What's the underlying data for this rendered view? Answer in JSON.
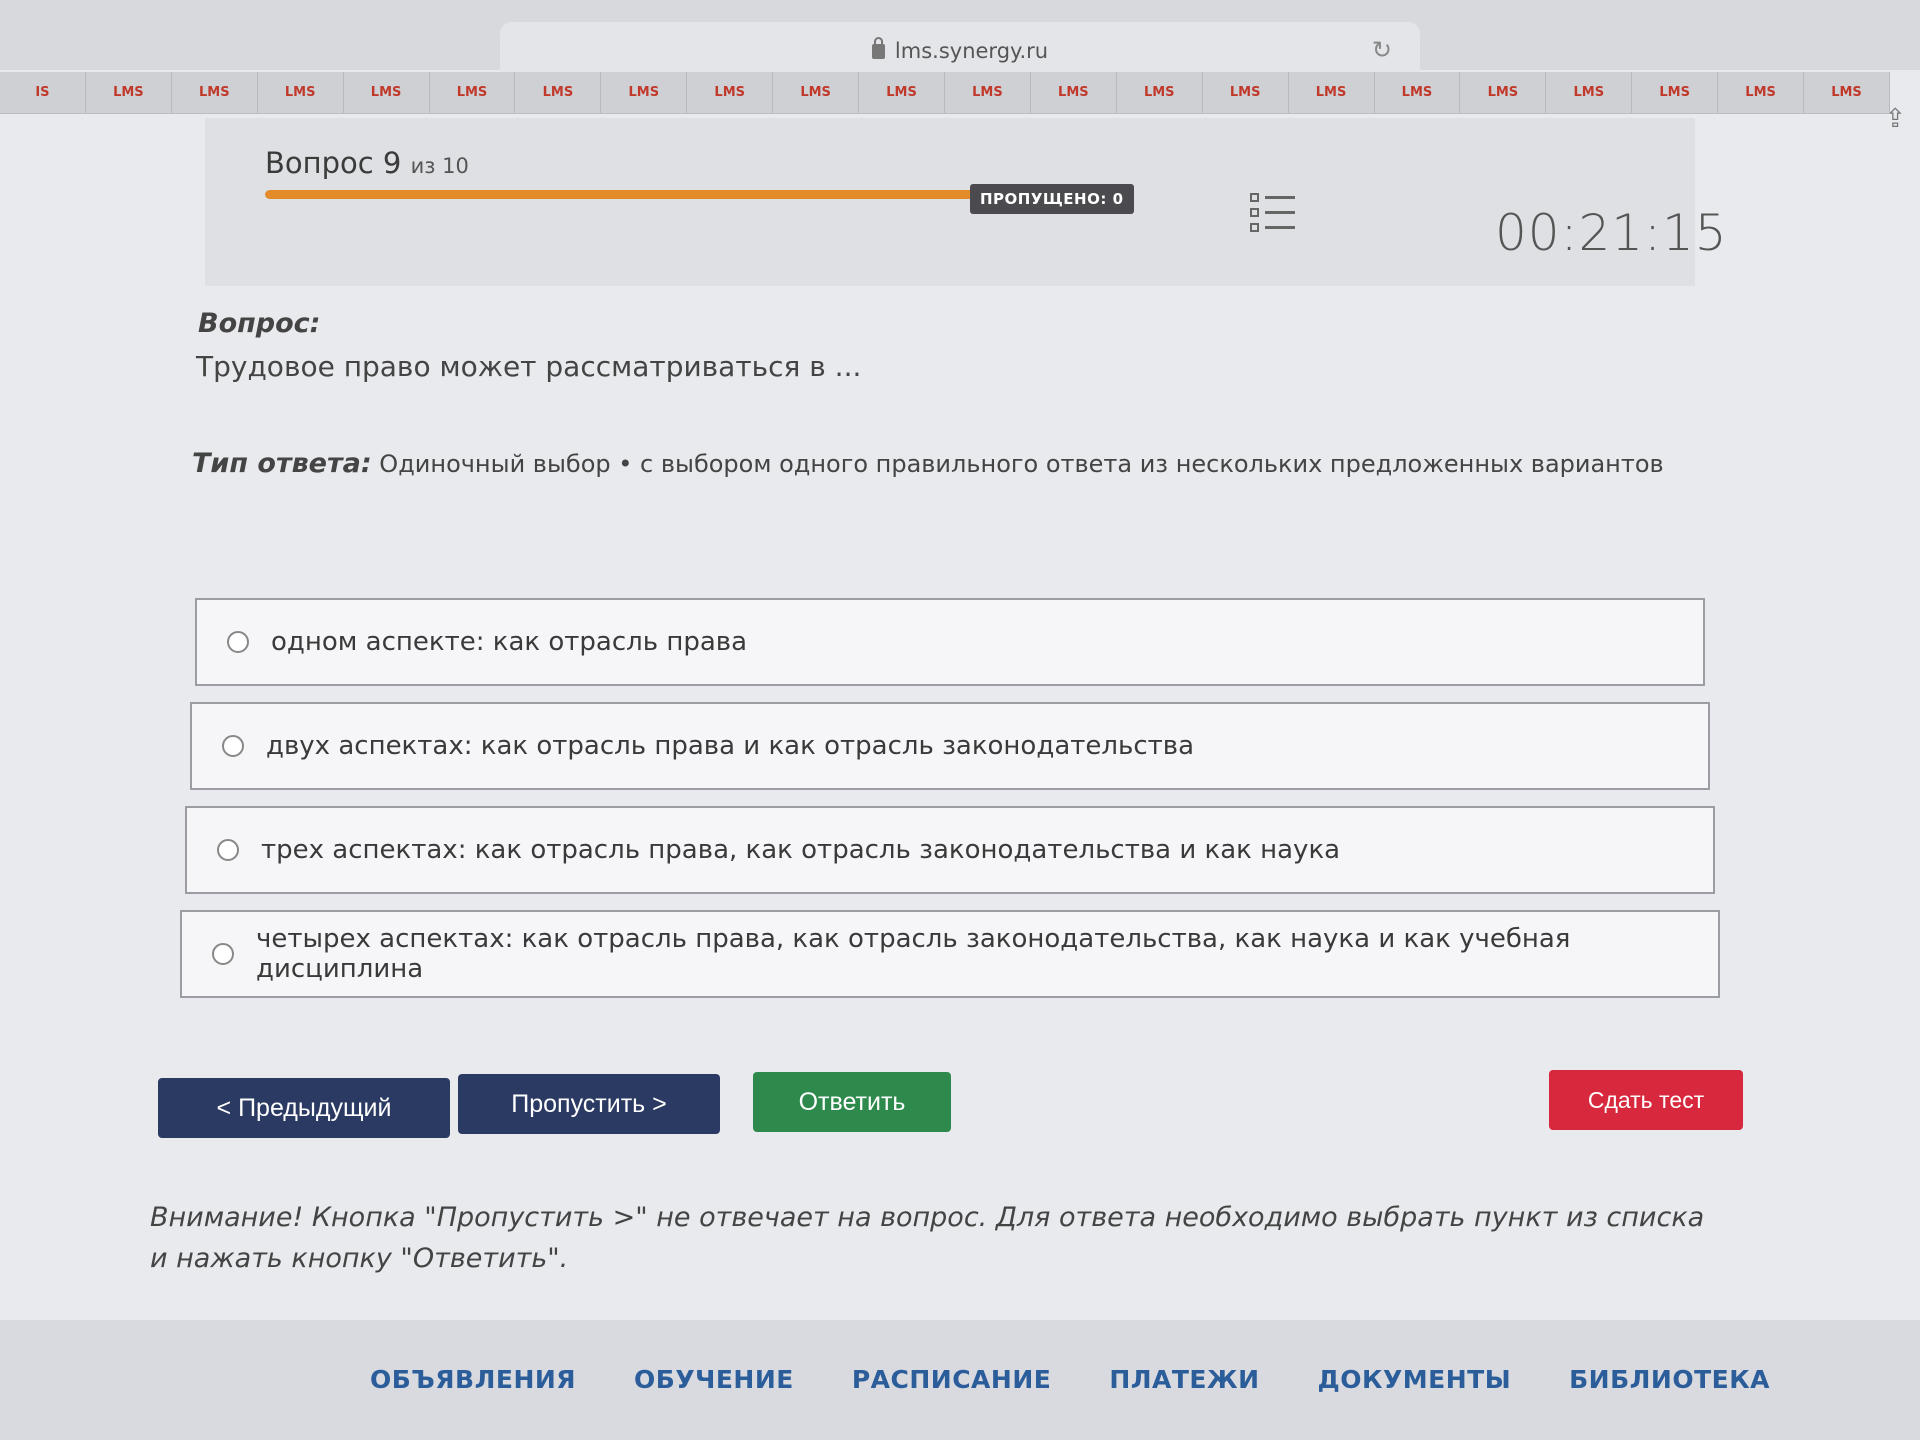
{
  "browser": {
    "url": "lms.synergy.ru",
    "tab_label": "LMS",
    "tabs": [
      "IS",
      "LMS",
      "LMS",
      "LMS",
      "LMS",
      "LMS",
      "LMS",
      "LMS",
      "LMS",
      "LMS",
      "LMS",
      "LMS",
      "LMS",
      "LMS",
      "LMS",
      "LMS",
      "LMS",
      "LMS",
      "LMS",
      "LMS",
      "LMS",
      "LMS"
    ]
  },
  "header": {
    "question_label": "Вопрос 9",
    "question_of": "из 10",
    "progress": 0.9,
    "skipped_badge": "ПРОПУЩЕНО: 0",
    "timer": "00:21:15"
  },
  "question": {
    "label": "Вопрос:",
    "text": "Трудовое право может рассматриваться в ...",
    "answer_type_label": "Тип ответа:",
    "answer_type_text": "Одиночный выбор • с выбором одного правильного ответа из нескольких предложенных вариантов"
  },
  "options": [
    "одном аспекте: как отрасль права",
    "двух аспектах: как отрасль права и как отрасль законодательства",
    "трех аспектах: как отрасль права, как отрасль законодательства и как наука",
    "четырех аспектах: как отрасль права, как отрасль законодательства, как наука и как учебная дисциплина"
  ],
  "buttons": {
    "prev": "< Предыдущий",
    "skip": "Пропустить >",
    "answer": "Ответить",
    "submit": "Сдать тест"
  },
  "warning": "Внимание! Кнопка \"Пропустить >\" не отвечает на вопрос. Для ответа необходимо выбрать пункт из списка и нажать кнопку \"Ответить\".",
  "bottom_nav": [
    "ОБЪЯВЛЕНИЯ",
    "ОБУЧЕНИЕ",
    "РАСПИСАНИЕ",
    "ПЛАТЕЖИ",
    "ДОКУМЕНТЫ",
    "БИБЛИОТЕКА"
  ]
}
